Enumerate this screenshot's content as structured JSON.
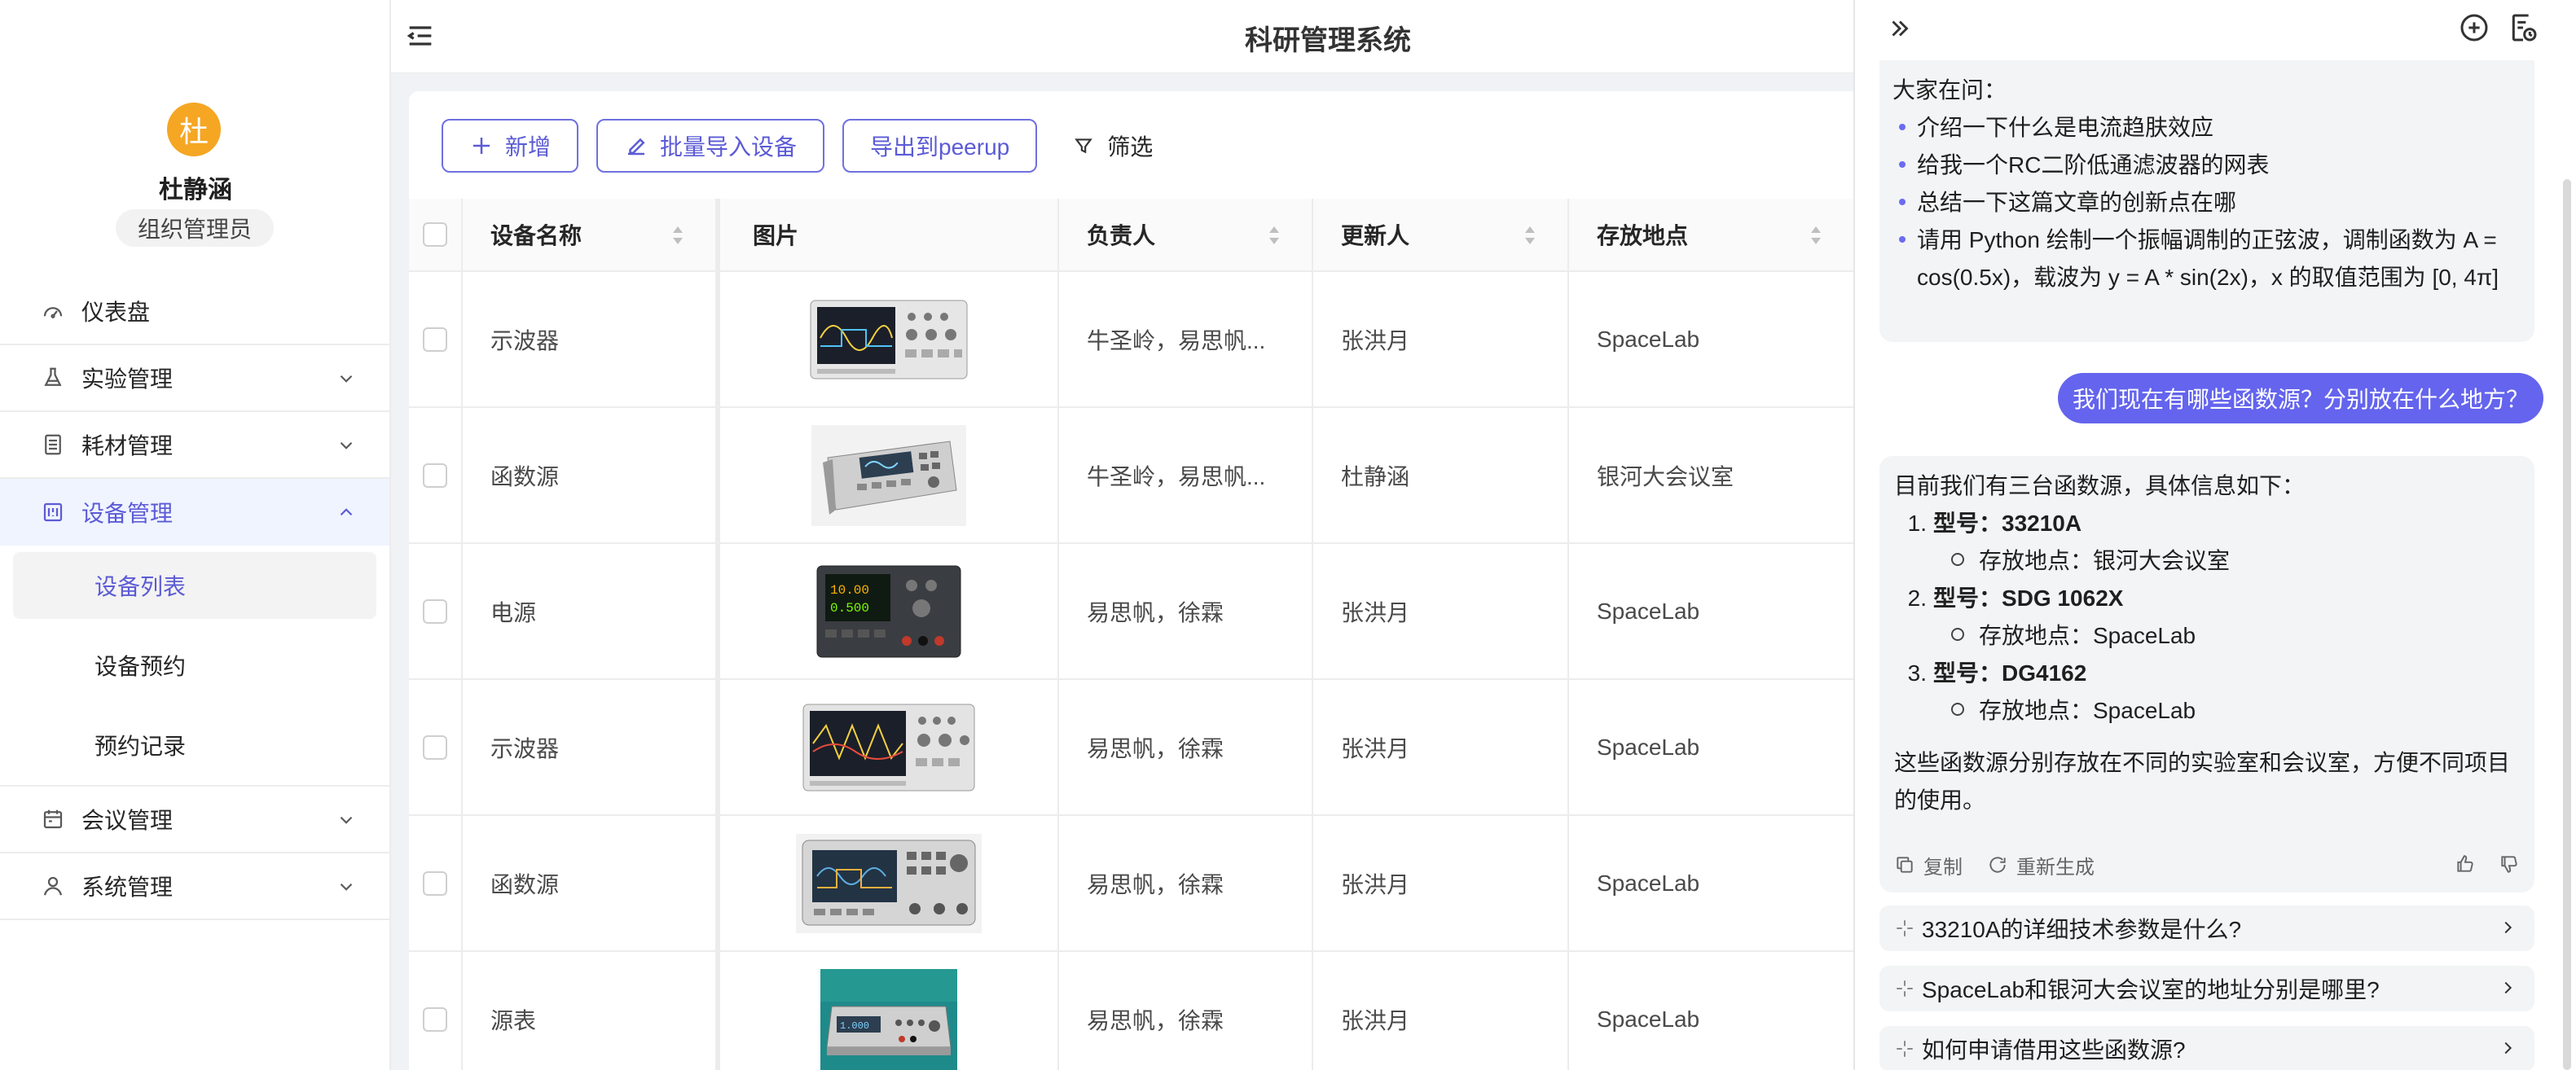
{
  "app": {
    "title": "科研管理系统"
  },
  "user": {
    "avatar_char": "杜",
    "name": "杜静涵",
    "role": "组织管理员"
  },
  "sidebar": {
    "items": [
      {
        "label": "仪表盘",
        "icon": "dashboard-icon"
      },
      {
        "label": "实验管理",
        "icon": "flask-icon"
      },
      {
        "label": "耗材管理",
        "icon": "ledger-icon"
      },
      {
        "label": "设备管理",
        "icon": "device-icon"
      },
      {
        "label": "会议管理",
        "icon": "calendar-icon"
      },
      {
        "label": "系统管理",
        "icon": "user-icon"
      }
    ],
    "device_submenu": [
      "设备列表",
      "设备预约",
      "预约记录"
    ]
  },
  "toolbar": {
    "add_label": "新增",
    "import_label": "批量导入设备",
    "export_label": "导出到peerup",
    "filter_label": "筛选"
  },
  "table": {
    "columns": [
      "设备名称",
      "图片",
      "负责人",
      "更新人",
      "存放地点"
    ],
    "rows": [
      {
        "name": "示波器",
        "owner": "牛圣岭，易思帆...",
        "updater": "张洪月",
        "location": "SpaceLab",
        "image": "oscilloscope"
      },
      {
        "name": "函数源",
        "owner": "牛圣岭，易思帆...",
        "updater": "杜静涵",
        "location": "银河大会议室",
        "image": "function-generator"
      },
      {
        "name": "电源",
        "owner": "易思帆，徐霖",
        "updater": "张洪月",
        "location": "SpaceLab",
        "image": "power-supply"
      },
      {
        "name": "示波器",
        "owner": "易思帆，徐霖",
        "updater": "张洪月",
        "location": "SpaceLab",
        "image": "oscilloscope"
      },
      {
        "name": "函数源",
        "owner": "易思帆，徐霖",
        "updater": "张洪月",
        "location": "SpaceLab",
        "image": "function-generator"
      },
      {
        "name": "源表",
        "owner": "易思帆，徐霖",
        "updater": "张洪月",
        "location": "SpaceLab",
        "image": "source-meter"
      }
    ]
  },
  "chat": {
    "suggest_title": "大家在问：",
    "suggestions": [
      "介绍一下什么是电流趋肤效应",
      "给我一个RC二阶低通滤波器的网表",
      "总结一下这篇文章的创新点在哪",
      "请用 Python 绘制一个振幅调制的正弦波，调制函数为 A = cos(0.5x)，载波为 y = A * sin(2x)，x 的取值范围为 [0, 4π]"
    ],
    "user_message": "我们现在有哪些函数源？分别放在什么地方？",
    "answer": {
      "intro": "目前我们有三台函数源，具体信息如下：",
      "items": [
        {
          "num": "1.",
          "label": "型号：",
          "model": "33210A",
          "location": "存放地点：银河大会议室"
        },
        {
          "num": "2.",
          "label": "型号：",
          "model": "SDG 1062X",
          "location": "存放地点：SpaceLab"
        },
        {
          "num": "3.",
          "label": "型号：",
          "model": "DG4162",
          "location": "存放地点：SpaceLab"
        }
      ],
      "summary": "这些函数源分别存放在不同的实验室和会议室，方便不同项目的使用。",
      "copy_label": "复制",
      "regenerate_label": "重新生成"
    },
    "followups": [
      "33210A的详细技术参数是什么?",
      "SpaceLab和银河大会议室的地址分别是哪里?",
      "如何申请借用这些函数源?"
    ]
  },
  "colors": {
    "accent": "#5b5bd6",
    "user_bubble": "#6464ee",
    "avatar": "#f5a623"
  }
}
